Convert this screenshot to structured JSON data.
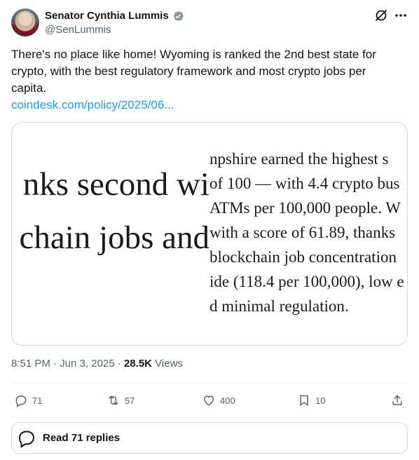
{
  "author": {
    "display_name": "Senator Cynthia Lummis",
    "handle": "@SenLummis",
    "verified_icon": "verified-badge-icon"
  },
  "tweet": {
    "text": "There's no place like home! Wyoming is ranked the 2nd best state for crypto, with the best regulatory framework and most crypto jobs per capita.",
    "link": "coindesk.com/policy/2025/06..."
  },
  "media": {
    "left_lines": [
      "nks second wi",
      "chain jobs and"
    ],
    "right_lines": [
      "npshire earned the highest s",
      "of 100 — with 4.4 crypto bus",
      "ATMs per 100,000 people. W",
      "with a score of 61.89, thanks",
      "blockchain job concentration",
      "ide (118.4 per 100,000), low e",
      "d minimal regulation."
    ]
  },
  "meta": {
    "time": "8:51 PM",
    "date": "Jun 3, 2025",
    "views_count": "28.5K",
    "views_label": "Views"
  },
  "actions": {
    "replies": "71",
    "reposts": "57",
    "likes": "400",
    "bookmarks": "10"
  },
  "read_replies": {
    "label": "Read 71 replies"
  },
  "colors": {
    "accent": "#1d9bf0",
    "secondary_text": "#536471",
    "border": "#cfd9de"
  }
}
